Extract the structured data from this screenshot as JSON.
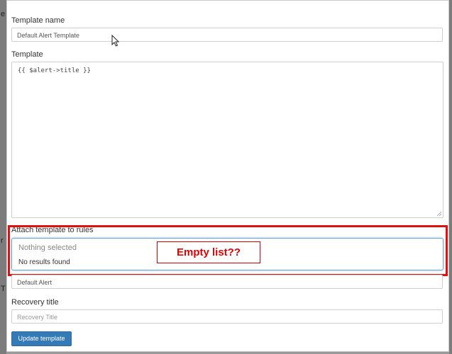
{
  "background_chars": [
    {
      "text": "e"
    },
    {
      "text": "r"
    },
    {
      "text": "T"
    }
  ],
  "form": {
    "template_name_label": "Template name",
    "template_name_value": "Default Alert Template",
    "template_label": "Template",
    "template_value": "{{ $alert->title }}",
    "attach_label": "Attach template to rules",
    "attach_placeholder": "Nothing selected",
    "attach_empty_text": "No results found",
    "title_value": "Default Alert",
    "recovery_title_label": "Recovery title",
    "recovery_title_placeholder": "Recovery Title",
    "submit_label": "Update template"
  },
  "annotation": {
    "text": "Empty list??"
  },
  "colors": {
    "highlight": "#e01010",
    "button": "#337ab7",
    "focus": "#6aa6d8"
  }
}
